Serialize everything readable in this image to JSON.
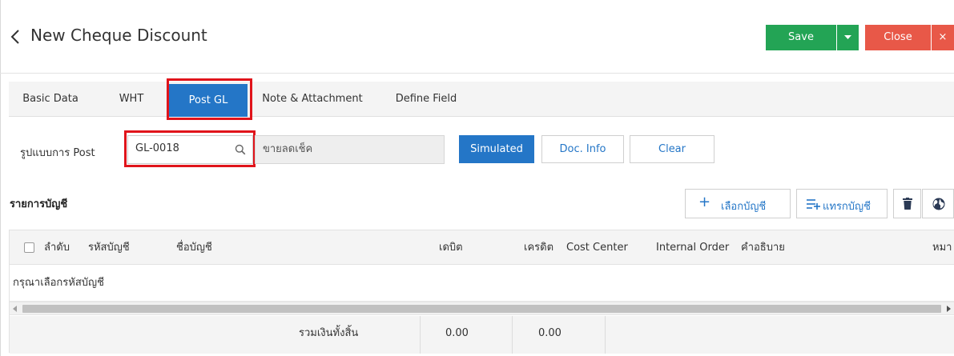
{
  "header": {
    "back_icon": "chevron-left-icon",
    "title": "New Cheque Discount",
    "save_label": "Save",
    "close_label": "Close",
    "close_x": "×",
    "colors": {
      "save": "#23a455",
      "close": "#e85848"
    }
  },
  "tabs": [
    {
      "label": "Basic Data",
      "active": false
    },
    {
      "label": "WHT",
      "active": false
    },
    {
      "label": "Post GL",
      "active": true
    },
    {
      "label": "Note & Attachment",
      "active": false
    },
    {
      "label": "Define Field",
      "active": false
    }
  ],
  "post": {
    "label": "รูปแบบการ Post",
    "code": "GL-0018",
    "description": "ขายลดเช็ค",
    "simulated_label": "Simulated",
    "docinfo_label": "Doc. Info",
    "clear_label": "Clear"
  },
  "accounts": {
    "title": "รายการบัญชี",
    "select_label": "เลือกบัญชี",
    "insert_label": "แทรกบัญชี",
    "columns": [
      "ลำดับ",
      "รหัสบัญชี",
      "ชื่อบัญชี",
      "เดบิต",
      "เครดิต",
      "Cost Center",
      "Internal Order",
      "คำอธิบาย",
      "หมา"
    ],
    "empty_message": "กรุณาเลือกรหัสบัญชี",
    "total_label": "รวมเงินทั้งสิ้น",
    "total_debit": "0.00",
    "total_credit": "0.00"
  },
  "accent_color": "#2476c7",
  "highlight_color": "#e0141b"
}
